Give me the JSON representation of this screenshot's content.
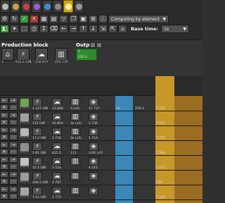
{
  "toolbar": {
    "compute_dropdown": "Computing by element",
    "base_time_label": "Base time:",
    "base_time_value": "1s"
  },
  "production_block": {
    "title": "Production block",
    "values": [
      "1",
      "932.2 GW",
      "1",
      "230 837",
      "250 239"
    ]
  },
  "output": {
    "title": "Output",
    "value_top": "1",
    "value_bottom": "250.3"
  },
  "rows": [
    {
      "pct": "100%",
      "a": "1 227 GW",
      "b": "13 808",
      "c": "3 (x2)",
      "d": "17 737",
      "e": "16",
      "f": "250.3",
      "g": "1 072"
    },
    {
      "pct": "100%",
      "a": "155 GW",
      "b": "10 803",
      "c": "3e (x5)",
      "d": "2 736",
      "e": "",
      "f": "",
      "g": "1 075"
    },
    {
      "pct": "100%",
      "a": "17.2 GW",
      "b": "3 776",
      "c": "3e (x5)",
      "d": "1 713",
      "e": "",
      "f": "",
      "g": "3 700"
    },
    {
      "pct": "100%",
      "a": "2.81 GW",
      "b": "815.2",
      "c": "111",
      "d": "3.06 (x1)",
      "e": "",
      "f": "",
      "g": "1 580"
    },
    {
      "pct": "100%",
      "a": "15.5 GW",
      "b": "5 223",
      "c": "",
      "d": "4 215",
      "e": "",
      "f": "",
      "g": "1 572"
    },
    {
      "pct": "100%",
      "a": "209.5 GW",
      "b": "4 787",
      "c": "",
      "d": "",
      "e": "",
      "f": "",
      "g": "750"
    },
    {
      "pct": "100%",
      "a": "7.15 GW",
      "b": "1 772",
      "c": "",
      "d": "",
      "e": "",
      "f": "",
      "g": "1 016"
    }
  ],
  "colors": {
    "accent_orange": "#c8972a",
    "accent_blue": "#3b87b7",
    "accent_green": "#3a9a3a"
  }
}
